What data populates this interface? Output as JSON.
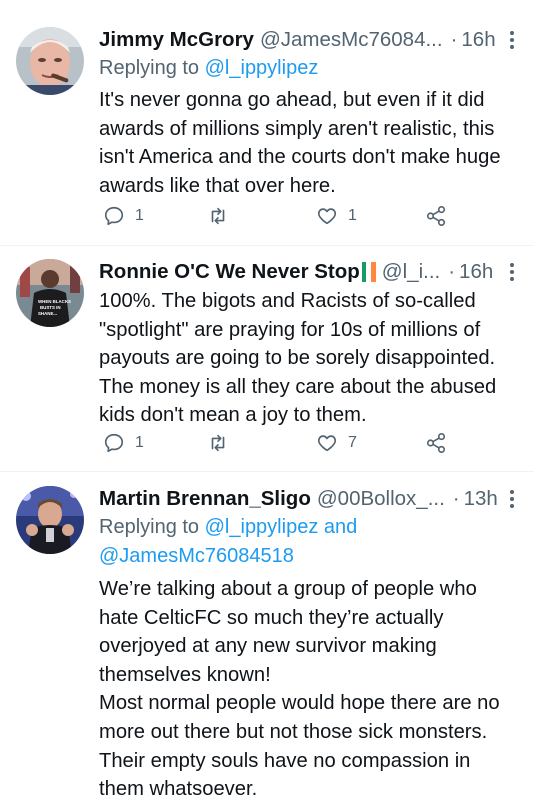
{
  "tweets": [
    {
      "name": "Jimmy McGrory",
      "handle": "@JamesMc76084...",
      "time": "16h",
      "replying_label": "Replying to",
      "replying_to": "@l_ippylipez",
      "replying_extra": "",
      "text": "It's never gonna go ahead, but even if it did awards of millions simply aren't realistic, this isn't America and the courts don't make huge awards like that over here.",
      "replies": "1",
      "retweets": "",
      "likes": "1"
    },
    {
      "name": "Ronnie O'C We Never Stop",
      "handle": "@l_i...",
      "time": "16h",
      "text": "100%. The bigots and Racists of so-called \"spotlight\" are praying for 10s of millions of payouts are going to be sorely disappointed. The money is all they care about the abused kids don't mean a joy to them.",
      "replies": "1",
      "retweets": "",
      "likes": "7"
    },
    {
      "name": "Martin Brennan_Sligo",
      "handle": "@00Bollox_...",
      "time": "13h",
      "replying_label": "Replying to",
      "replying_to": "@l_ippylipez and",
      "replying_extra": "@JamesMc76084518",
      "text": "We’re talking about a group of people who hate CelticFC so much they’re actually overjoyed at any new survivor making themselves known!\nMost normal people would hope there are no more out there but not those sick monsters. Their empty souls have no compassion in them whatsoever."
    }
  ],
  "avatar_shirt_text": [
    "WHEN BLACKS",
    "BUSTS IN",
    "SHANE..."
  ],
  "colors": {
    "accent": "#1d9bf0",
    "muted": "#536471",
    "text": "#0f1419",
    "flag_green": "#169b62",
    "flag_white": "#ffffff",
    "flag_orange": "#ff883e"
  },
  "icons": [
    "reply-icon",
    "retweet-icon",
    "like-icon",
    "share-icon",
    "more-icon",
    "ireland-flag-icon"
  ]
}
